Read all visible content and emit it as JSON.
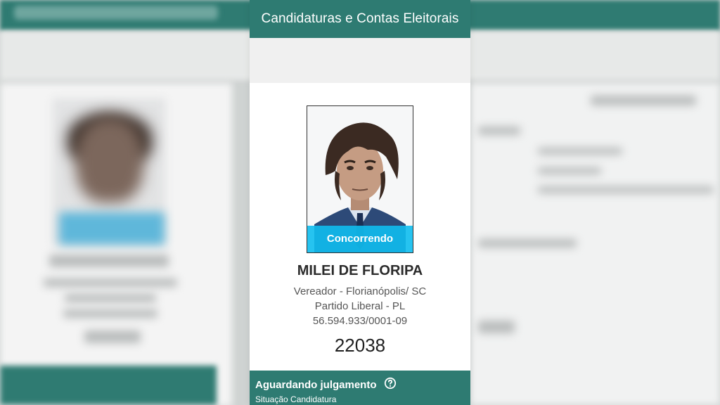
{
  "header": {
    "title": "Candidaturas e Contas Eleitorais"
  },
  "candidate": {
    "photo_badge": "Concorrendo",
    "name": "MILEI DE FLORIPA",
    "role_location": "Vereador - Florianópolis/ SC",
    "party": "Partido Liberal - PL",
    "cnpj": "56.594.933/0001-09",
    "number": "22038"
  },
  "status": {
    "title": "Aguardando julgamento",
    "subtitle": "Situação Candidatura",
    "help_icon": "question-circle-icon"
  },
  "colors": {
    "teal": "#2e7b72",
    "badge_blue": "#10bcee",
    "card_bg": "#ffffff"
  }
}
